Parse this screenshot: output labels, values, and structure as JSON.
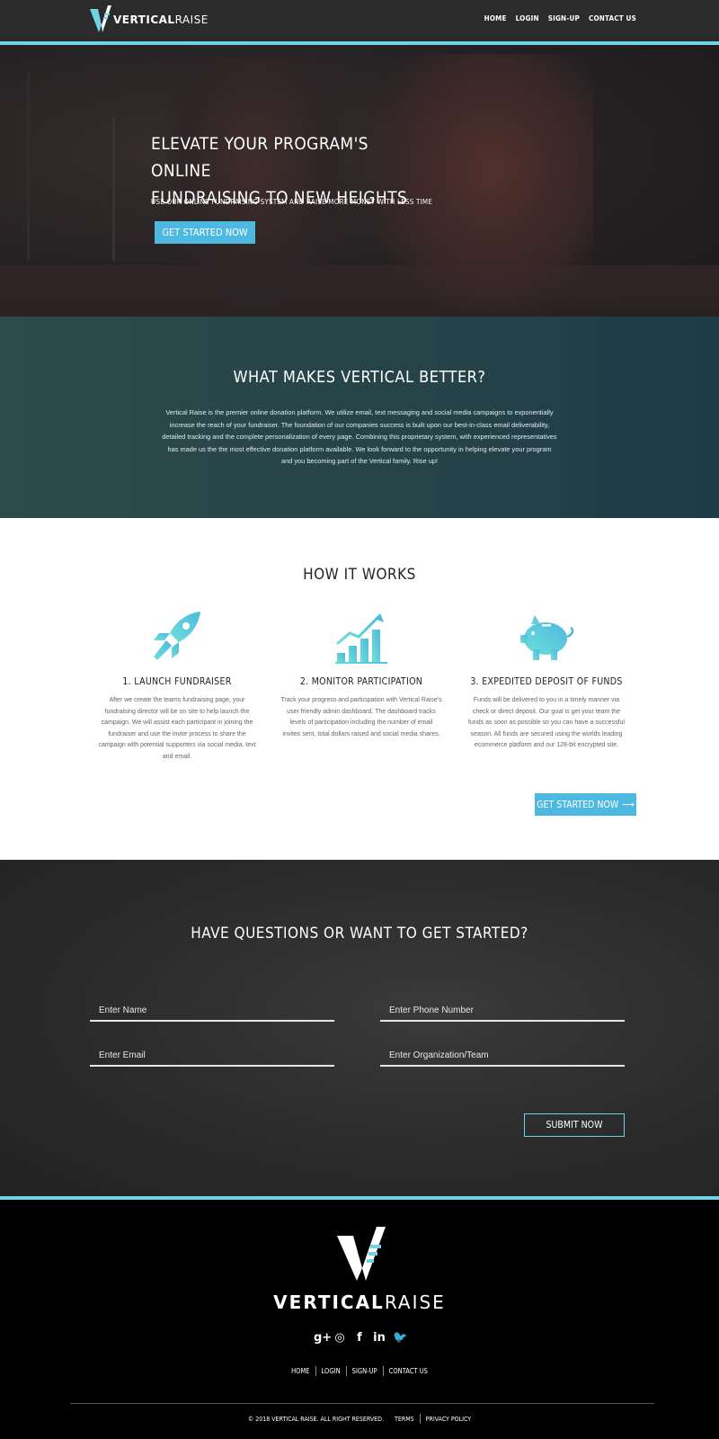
{
  "brand": {
    "word_bold": "VERTICAL",
    "word_light": "RAISE",
    "accent": "#6fd3e4",
    "button": "#4db9e0"
  },
  "nav": {
    "items": [
      "HOME",
      "LOGIN",
      "SIGN-UP",
      "CONTACT US"
    ]
  },
  "hero": {
    "headline_1": "ELEVATE YOUR PROGRAM'S ONLINE",
    "headline_2": "FUNDRAISING TO NEW HEIGHTS",
    "subhead": "USE OUR ONLINE FUNDRAISING SYSTEM AND RAISE MORE MONEY WITH LESS TIME",
    "cta": "GET STARTED NOW"
  },
  "better": {
    "title": "WHAT MAKES VERTICAL BETTER?",
    "body": "Vertical Raise is the premier online donation platform. We utilize email, text messaging and social media campaigns to exponentially increase the reach of your fundraiser. The foundation of our companies success is built upon our best-in-class email deliverability, detailed tracking and the complete personalization of every page. Combining this proprietary system, with experienced representatives has made us the the most effective donation platform available. We look forward to the opportunity in helping elevate your program and you becoming part of the Vertical family. Rise up!"
  },
  "how": {
    "title": "HOW IT WORKS",
    "steps": [
      {
        "title": "1. LAUNCH FUNDRAISER",
        "icon": "rocket-icon",
        "body": "After we create the teams fundraising page, your fundraising director will be on site to help launch the campaign. We will assist each participant in joining the fundraiser and use the invite process to share the campaign with potential supporters via social media, text and email."
      },
      {
        "title": "2. MONITOR PARTICIPATION",
        "icon": "bar-chart-icon",
        "body": "Track your progress and participation with Vertical Raise's user friendly admin dashboard. The dashboard tracks levels of participation including the number of email invites sent, total dollars raised and social media shares."
      },
      {
        "title": "3. EXPEDITED DEPOSIT OF FUNDS",
        "icon": "piggy-bank-icon",
        "body": "Funds will be delivered to you in a timely manner via check or direct deposit. Our goal is get your team the funds as soon as possible so you can have a successful season. All funds are secured using the worlds leading ecommerce platform and our 128-bit encrypted site."
      }
    ],
    "cta": "GET STARTED NOW",
    "cta_arrow": "⟶"
  },
  "contact": {
    "title": "HAVE QUESTIONS OR WANT TO GET STARTED?",
    "name_placeholder": "Enter Name",
    "phone_placeholder": "Enter Phone Number",
    "email_placeholder": "Enter Email",
    "org_placeholder": "Enter Organization/Team",
    "submit": "SUBMIT NOW"
  },
  "footer": {
    "social": [
      "g+",
      "◎",
      "f",
      "in",
      "🐦"
    ],
    "menu": [
      "HOME",
      "LOGIN",
      "SIGN-UP",
      "CONTACT US"
    ],
    "copyright": "© 2018 VERTICAL RAISE. ALL RIGHT RESERVED.",
    "terms": "TERMS",
    "privacy": "PRIVACY POLICY"
  }
}
